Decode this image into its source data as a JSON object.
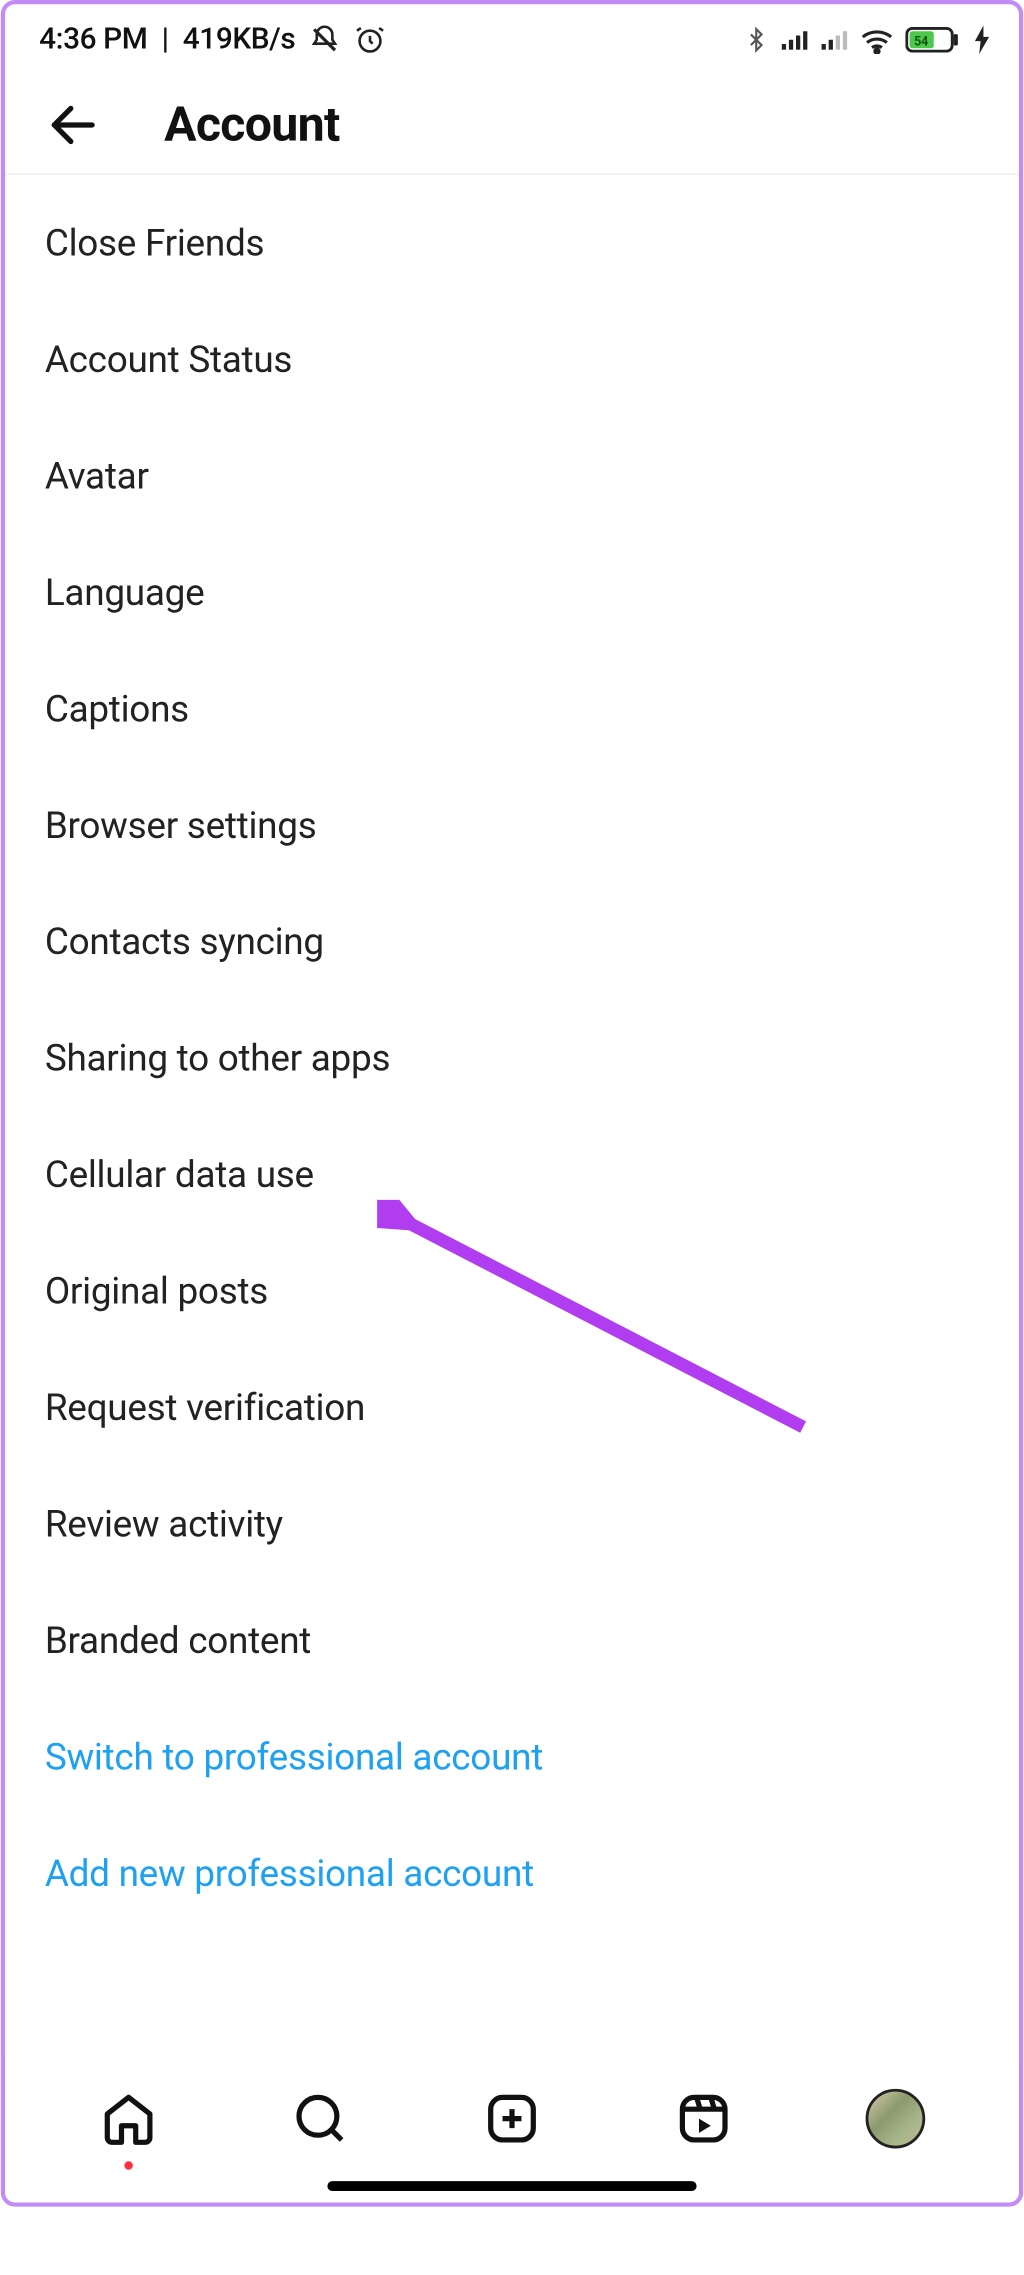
{
  "statusbar": {
    "time": "4:36 PM",
    "speed": "419KB/s",
    "battery": "54"
  },
  "header": {
    "title": "Account"
  },
  "menu": {
    "items": [
      {
        "label": "Close Friends",
        "link": false
      },
      {
        "label": "Account Status",
        "link": false
      },
      {
        "label": "Avatar",
        "link": false
      },
      {
        "label": "Language",
        "link": false
      },
      {
        "label": "Captions",
        "link": false
      },
      {
        "label": "Browser settings",
        "link": false
      },
      {
        "label": "Contacts syncing",
        "link": false
      },
      {
        "label": "Sharing to other apps",
        "link": false
      },
      {
        "label": "Cellular data use",
        "link": false
      },
      {
        "label": "Original posts",
        "link": false
      },
      {
        "label": "Request verification",
        "link": false
      },
      {
        "label": "Review activity",
        "link": false
      },
      {
        "label": "Branded content",
        "link": false
      },
      {
        "label": "Switch to professional account",
        "link": true
      },
      {
        "label": "Add new professional account",
        "link": true
      }
    ]
  },
  "annotation": {
    "target": "Cellular data use",
    "color": "#b13df0"
  }
}
